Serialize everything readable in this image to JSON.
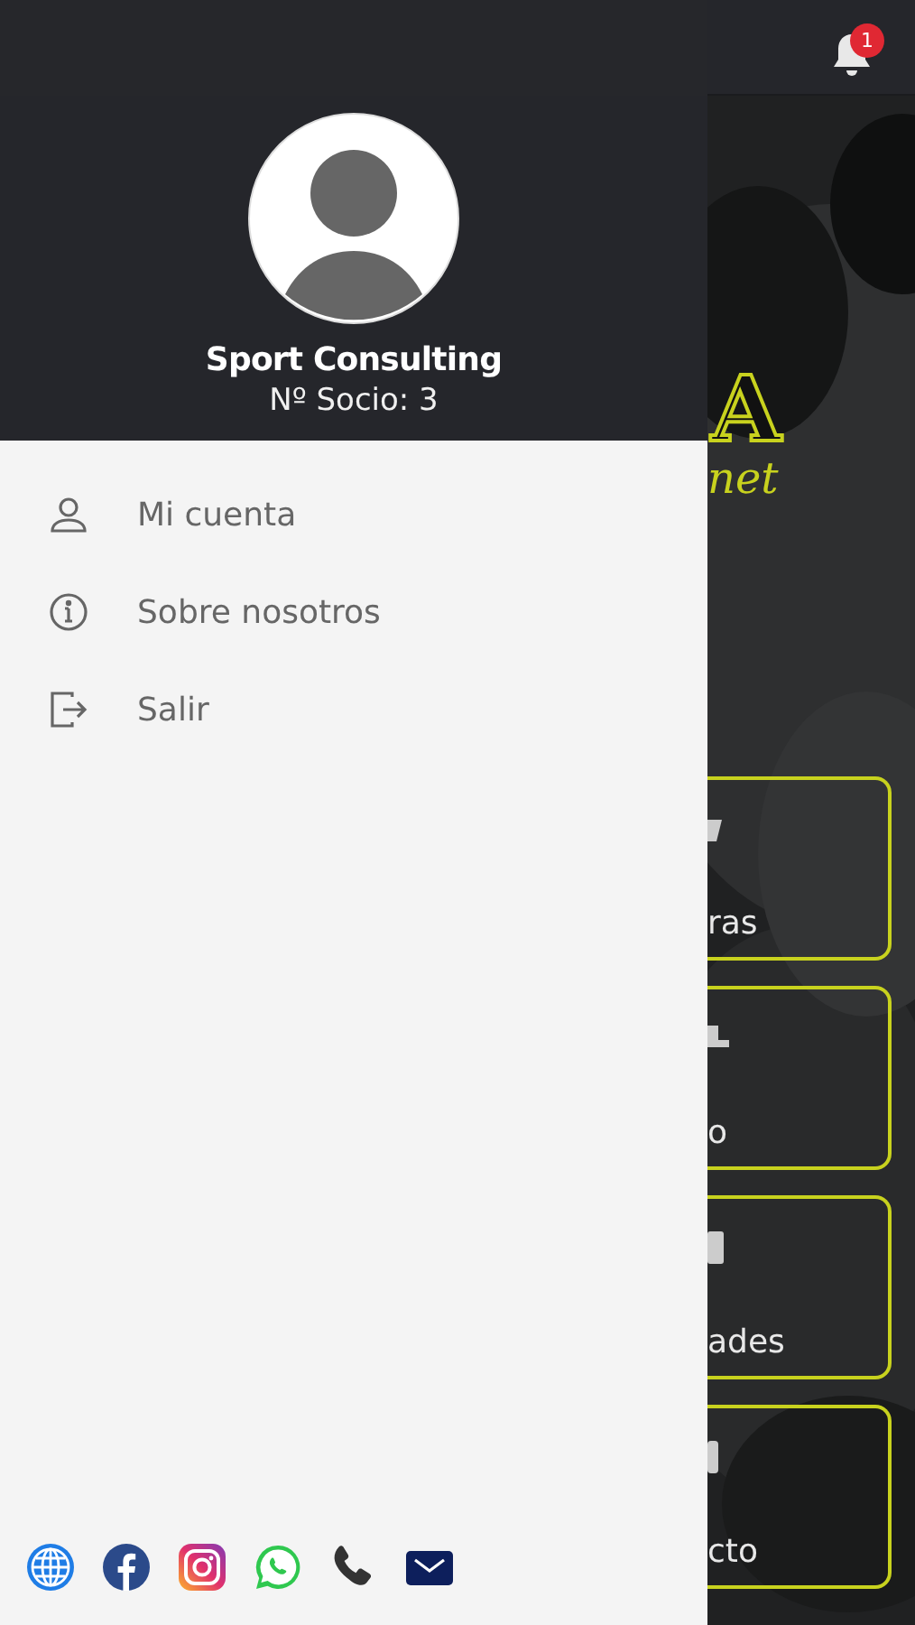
{
  "top_bar": {
    "notification_count": "1"
  },
  "background": {
    "logo": {
      "letter": "A",
      "script": "net"
    },
    "cards": [
      {
        "label": "ras"
      },
      {
        "label": "o"
      },
      {
        "label": "ades"
      },
      {
        "label": "cto"
      }
    ]
  },
  "drawer": {
    "user": {
      "name": "Sport Consulting",
      "member_number": "Nº Socio: 3"
    },
    "menu": [
      {
        "kind": "person",
        "label": "Mi cuenta"
      },
      {
        "kind": "info",
        "label": "Sobre nosotros"
      },
      {
        "kind": "logout",
        "label": "Salir"
      }
    ],
    "social_links": [
      {
        "kind": "web"
      },
      {
        "kind": "facebook"
      },
      {
        "kind": "instagram"
      },
      {
        "kind": "whatsapp"
      },
      {
        "kind": "phone"
      },
      {
        "kind": "email"
      }
    ]
  }
}
